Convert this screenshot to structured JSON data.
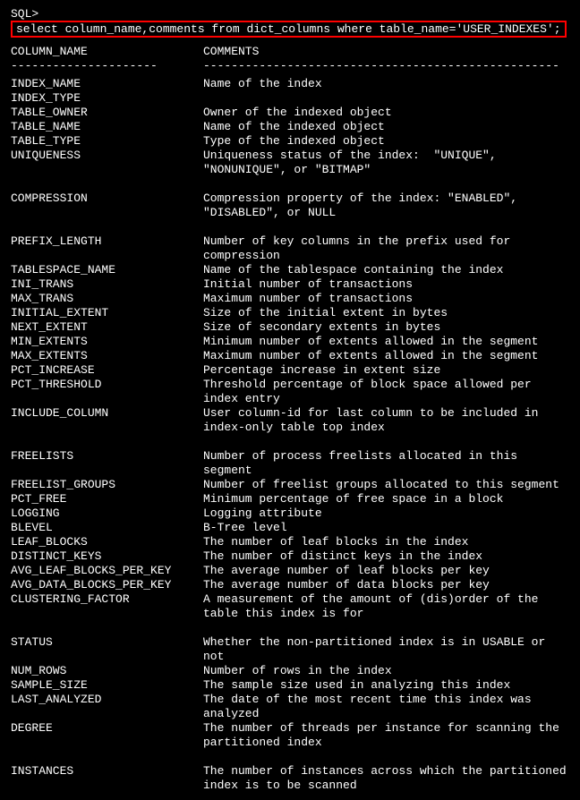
{
  "prompt": "SQL>",
  "command": "select column_name,comments from dict_columns where table_name='USER_INDEXES';",
  "headers": {
    "col1": "COLUMN_NAME",
    "col2": "COMMENTS"
  },
  "separators": {
    "col1": "---------------------",
    "col2": "---------------------------------------------------"
  },
  "rows": [
    {
      "name": "INDEX_NAME",
      "comment": "Name of the index",
      "gap": false
    },
    {
      "name": "INDEX_TYPE",
      "comment": "",
      "gap": false
    },
    {
      "name": "TABLE_OWNER",
      "comment": "Owner of the indexed object",
      "gap": false
    },
    {
      "name": "TABLE_NAME",
      "comment": "Name of the indexed object",
      "gap": false
    },
    {
      "name": "TABLE_TYPE",
      "comment": "Type of the indexed object",
      "gap": false
    },
    {
      "name": "UNIQUENESS",
      "comment": "Uniqueness status of the index:  \"UNIQUE\",  \"NONUNIQUE\", or \"BITMAP\"",
      "gap": true
    },
    {
      "name": "COMPRESSION",
      "comment": "Compression property of the index: \"ENABLED\",  \"DISABLED\", or NULL",
      "gap": true
    },
    {
      "name": "PREFIX_LENGTH",
      "comment": "Number of key columns in the prefix used for compression",
      "gap": false
    },
    {
      "name": "TABLESPACE_NAME",
      "comment": "Name of the tablespace containing the index",
      "gap": false
    },
    {
      "name": "INI_TRANS",
      "comment": "Initial number of transactions",
      "gap": false
    },
    {
      "name": "MAX_TRANS",
      "comment": "Maximum number of transactions",
      "gap": false
    },
    {
      "name": "INITIAL_EXTENT",
      "comment": "Size of the initial extent in bytes",
      "gap": false
    },
    {
      "name": "NEXT_EXTENT",
      "comment": "Size of secondary extents in bytes",
      "gap": false
    },
    {
      "name": "MIN_EXTENTS",
      "comment": "Minimum number of extents allowed in the segment",
      "gap": false
    },
    {
      "name": "MAX_EXTENTS",
      "comment": "Maximum number of extents allowed in the segment",
      "gap": false
    },
    {
      "name": "PCT_INCREASE",
      "comment": "Percentage increase in extent size",
      "gap": false
    },
    {
      "name": "PCT_THRESHOLD",
      "comment": "Threshold percentage of block space allowed per index entry",
      "gap": false
    },
    {
      "name": "INCLUDE_COLUMN",
      "comment": "User column-id for last column to be included in index-only table top index",
      "gap": true
    },
    {
      "name": "FREELISTS",
      "comment": "Number of process freelists allocated in this segment",
      "gap": false
    },
    {
      "name": "FREELIST_GROUPS",
      "comment": "Number of freelist groups allocated to this segment",
      "gap": false
    },
    {
      "name": "PCT_FREE",
      "comment": "Minimum percentage of free space in a block",
      "gap": false
    },
    {
      "name": "LOGGING",
      "comment": "Logging attribute",
      "gap": false
    },
    {
      "name": "BLEVEL",
      "comment": "B-Tree level",
      "gap": false
    },
    {
      "name": "LEAF_BLOCKS",
      "comment": "The number of leaf blocks in the index",
      "gap": false
    },
    {
      "name": "DISTINCT_KEYS",
      "comment": "The number of distinct keys in the index",
      "gap": false
    },
    {
      "name": "AVG_LEAF_BLOCKS_PER_KEY",
      "comment": "The average number of leaf blocks per key",
      "gap": false
    },
    {
      "name": "AVG_DATA_BLOCKS_PER_KEY",
      "comment": "The average number of data blocks per key",
      "gap": false
    },
    {
      "name": "CLUSTERING_FACTOR",
      "comment": "A measurement of the amount of (dis)order of the table this index is for",
      "gap": true
    },
    {
      "name": "STATUS",
      "comment": "Whether the non-partitioned index is in USABLE or not",
      "gap": false
    },
    {
      "name": "NUM_ROWS",
      "comment": "Number of rows in the index",
      "gap": false
    },
    {
      "name": "SAMPLE_SIZE",
      "comment": "The sample size used in analyzing this index",
      "gap": false
    },
    {
      "name": "LAST_ANALYZED",
      "comment": "The date of the most recent time this index was analyzed",
      "gap": false
    },
    {
      "name": "DEGREE",
      "comment": "The number of threads per instance for scanning the partitioned index",
      "gap": true
    },
    {
      "name": "INSTANCES",
      "comment": "The number of instances across which the partitioned index is to be scanned",
      "gap": false
    }
  ]
}
